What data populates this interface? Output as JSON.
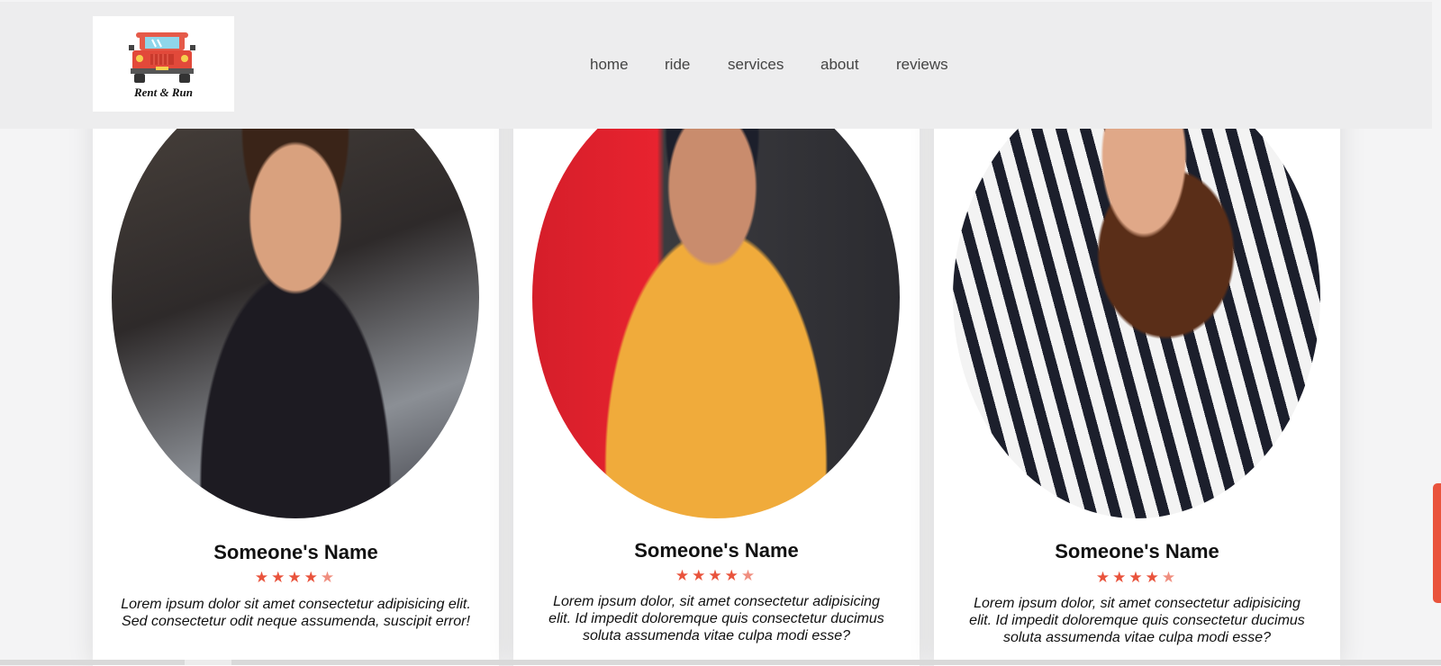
{
  "brand": {
    "logo_text": "Rent & Run"
  },
  "nav": {
    "items": [
      "home",
      "ride",
      "services",
      "about",
      "reviews"
    ]
  },
  "reviews": [
    {
      "name": "Someone's Name",
      "rating": 4.5,
      "stars": "★★★★",
      "half_star": "★",
      "lines": [
        "Lorem ipsum dolor sit amet consectetur adipisicing elit.",
        "Sed consectetur odit neque assumenda, suscipit error!"
      ]
    },
    {
      "name": "Someone's Name",
      "rating": 4.5,
      "stars": "★★★★",
      "half_star": "★",
      "lines": [
        "Lorem ipsum dolor, sit amet consectetur adipisicing",
        "elit. Id impedit doloremque quis consectetur ducimus",
        "soluta assumenda vitae culpa modi esse?"
      ]
    },
    {
      "name": "Someone's Name",
      "rating": 4.5,
      "stars": "★★★★",
      "half_star": "★",
      "lines": [
        "Lorem ipsum dolor, sit amet consectetur adipisicing",
        "elit. Id impedit doloremque quis consectetur ducimus",
        "soluta assumenda vitae culpa modi esse?"
      ]
    }
  ],
  "colors": {
    "accent": "#e9533c",
    "header_bg": "#ededee"
  }
}
